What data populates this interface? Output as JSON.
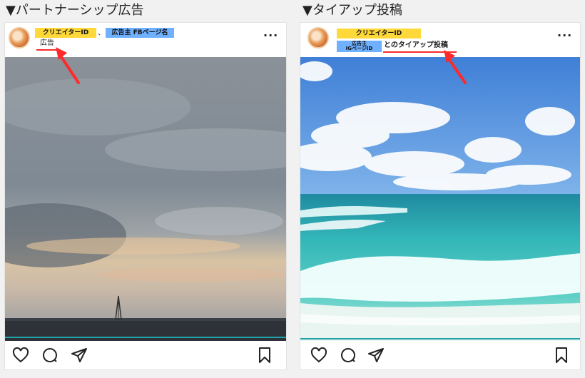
{
  "left": {
    "heading": "▼パートナーシップ広告",
    "creator_tag": "クリエイターID",
    "separator": "、",
    "advertiser_tag": "広告主 FBページ名",
    "sponsored_label": "広告",
    "more_label": "···"
  },
  "right": {
    "heading": "▼タイアップ投稿",
    "creator_tag": "クリエイターID",
    "advertiser_tag_line1": "広告主",
    "advertiser_tag_line2": "IGページID",
    "tieup_label": "とのタイアップ投稿",
    "more_label": "···"
  },
  "icons": [
    "heart-icon",
    "comment-icon",
    "share-icon",
    "bookmark-icon",
    "red-arrow-icon"
  ],
  "colors": {
    "highlight_yellow": "#ffd83a",
    "highlight_blue": "#6fb0ff",
    "annotation_red": "#ff2a2a"
  }
}
